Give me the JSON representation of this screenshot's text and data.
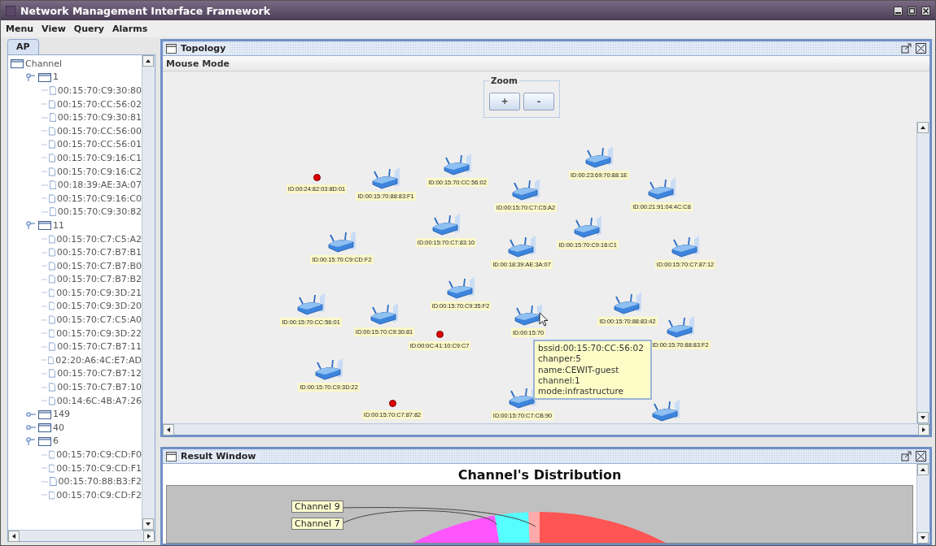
{
  "window": {
    "title": "Network Management Interface Framework"
  },
  "menu": [
    "Menu",
    "View",
    "Query",
    "Alarms"
  ],
  "left_tabs": [
    {
      "label": "AP",
      "selected": true
    }
  ],
  "tree": {
    "label": "Channel",
    "children": [
      {
        "label": "1",
        "expanded": true,
        "children": [
          {
            "label": "00:15:70:C9:30:80"
          },
          {
            "label": "00:15:70:CC:56:02"
          },
          {
            "label": "00:15:70:C9:30:81"
          },
          {
            "label": "00:15:70:CC:56:00"
          },
          {
            "label": "00:15:70:CC:56:01"
          },
          {
            "label": "00:15:70:C9:16:C1"
          },
          {
            "label": "00:15:70:C9:16:C2"
          },
          {
            "label": "00:18:39:AE:3A:07"
          },
          {
            "label": "00:15:70:C9:16:C0"
          },
          {
            "label": "00:15:70:C9:30:82"
          }
        ]
      },
      {
        "label": "11",
        "expanded": true,
        "children": [
          {
            "label": "00:15:70:C7:C5:A2"
          },
          {
            "label": "00:15:70:C7:B7:B1"
          },
          {
            "label": "00:15:70:C7:B7:B0"
          },
          {
            "label": "00:15:70:C7:B7:B2"
          },
          {
            "label": "00:15:70:C9:3D:21"
          },
          {
            "label": "00:15:70:C9:3D:20"
          },
          {
            "label": "00:15:70:C7:C5:A0"
          },
          {
            "label": "00:15:70:C9:3D:22"
          },
          {
            "label": "00:15:70:C7:B7:11"
          },
          {
            "label": "02:20:A6:4C:E7:AD"
          },
          {
            "label": "00:15:70:C7:B7:12"
          },
          {
            "label": "00:15:70:C7:B7:10"
          },
          {
            "label": "00:14:6C:4B:A7:26"
          }
        ]
      },
      {
        "label": "149",
        "expanded": false
      },
      {
        "label": "40",
        "expanded": false
      },
      {
        "label": "6",
        "expanded": true,
        "children": [
          {
            "label": "00:15:70:C9:CD:F0"
          },
          {
            "label": "00:15:70:C9:CD:F1"
          },
          {
            "label": "00:15:70:88:B3:F2"
          },
          {
            "label": "00:15:70:C9:CD:F2"
          }
        ]
      }
    ]
  },
  "topology": {
    "title": "Topology",
    "toolbar": "Mouse Mode",
    "zoom": {
      "title": "Zoom",
      "buttons": [
        "+",
        "-"
      ]
    },
    "nodes": [
      {
        "kind": "dot",
        "label": "ID:00:24:82:03:8D:01"
      },
      {
        "kind": "router",
        "label": "ID:00:15:70:88:83:F1"
      },
      {
        "kind": "router",
        "label": "ID:00:15:70:CC:56:02"
      },
      {
        "kind": "router",
        "label": "ID:00:23:69:70:88:1E"
      },
      {
        "kind": "router",
        "label": "ID:00:15:70:C7:C5:A2"
      },
      {
        "kind": "router",
        "label": "ID:00:21:91:04:4C:C8"
      },
      {
        "kind": "router",
        "label": "ID:00:15:70:C9:CD:F2"
      },
      {
        "kind": "router",
        "label": "ID:00:15:70:C7:83:10"
      },
      {
        "kind": "router",
        "label": "ID:00:18:39:AE:3A:07"
      },
      {
        "kind": "router",
        "label": "ID:00:15:70:C9:16:C1"
      },
      {
        "kind": "router",
        "label": "ID:00:15:70:C7:87:12"
      },
      {
        "kind": "router",
        "label": "ID:00:15:70:C9:35:F2"
      },
      {
        "kind": "router",
        "label": "ID:00:15:70:CC:56:01"
      },
      {
        "kind": "router",
        "label": "ID:00:15:70:C9:30:81"
      },
      {
        "kind": "dot",
        "label": "ID:00:0C:41:10:C9:C7"
      },
      {
        "kind": "router",
        "label": "ID:00:15:70"
      },
      {
        "kind": "router",
        "label": "ID:00:15:70:88:83:42"
      },
      {
        "kind": "router",
        "label": "ID:00:15:70:88:83:F2"
      },
      {
        "kind": "router",
        "label": "ID:00:15:70:C9:3D:22"
      },
      {
        "kind": "dot",
        "label": "ID:00:15:70:C7:87:82"
      },
      {
        "kind": "router",
        "label": "ID:00:15:70:C7:CB:90"
      },
      {
        "kind": "router"
      }
    ],
    "tooltip": [
      "bssid:00:15:70:CC:56:02",
      "chanper:5",
      "name:CEWIT-guest",
      "channel:1",
      "mode:infrastructure"
    ]
  },
  "result": {
    "title": "Result Window",
    "chart_title": "Channel's Distribution",
    "slice_labels": [
      "Channel 9",
      "Channel 7"
    ]
  }
}
